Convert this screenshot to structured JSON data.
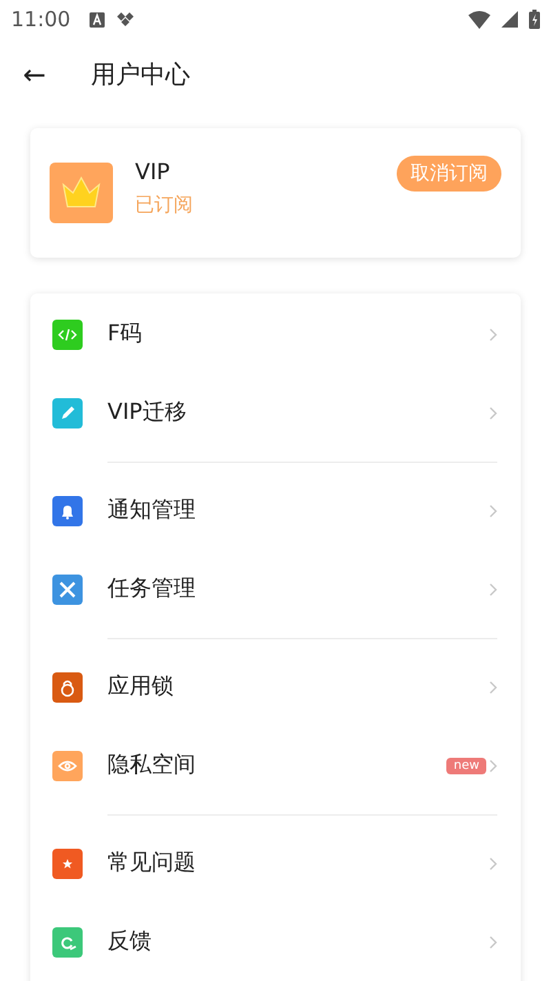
{
  "status_bar": {
    "time": "11:00"
  },
  "header": {
    "back": "←",
    "title": "用户中心"
  },
  "vip_card": {
    "name": "VIP",
    "status": "已订阅",
    "action": "取消订阅"
  },
  "sections": [
    {
      "items": [
        {
          "label": "F码"
        },
        {
          "label": "VIP迁移"
        }
      ]
    },
    {
      "items": [
        {
          "label": "通知管理"
        },
        {
          "label": "任务管理"
        }
      ]
    },
    {
      "items": [
        {
          "label": "应用锁"
        },
        {
          "label": "隐私空间",
          "badge": "new"
        }
      ]
    },
    {
      "items": [
        {
          "label": "常见问题"
        },
        {
          "label": "反馈"
        }
      ]
    }
  ]
}
